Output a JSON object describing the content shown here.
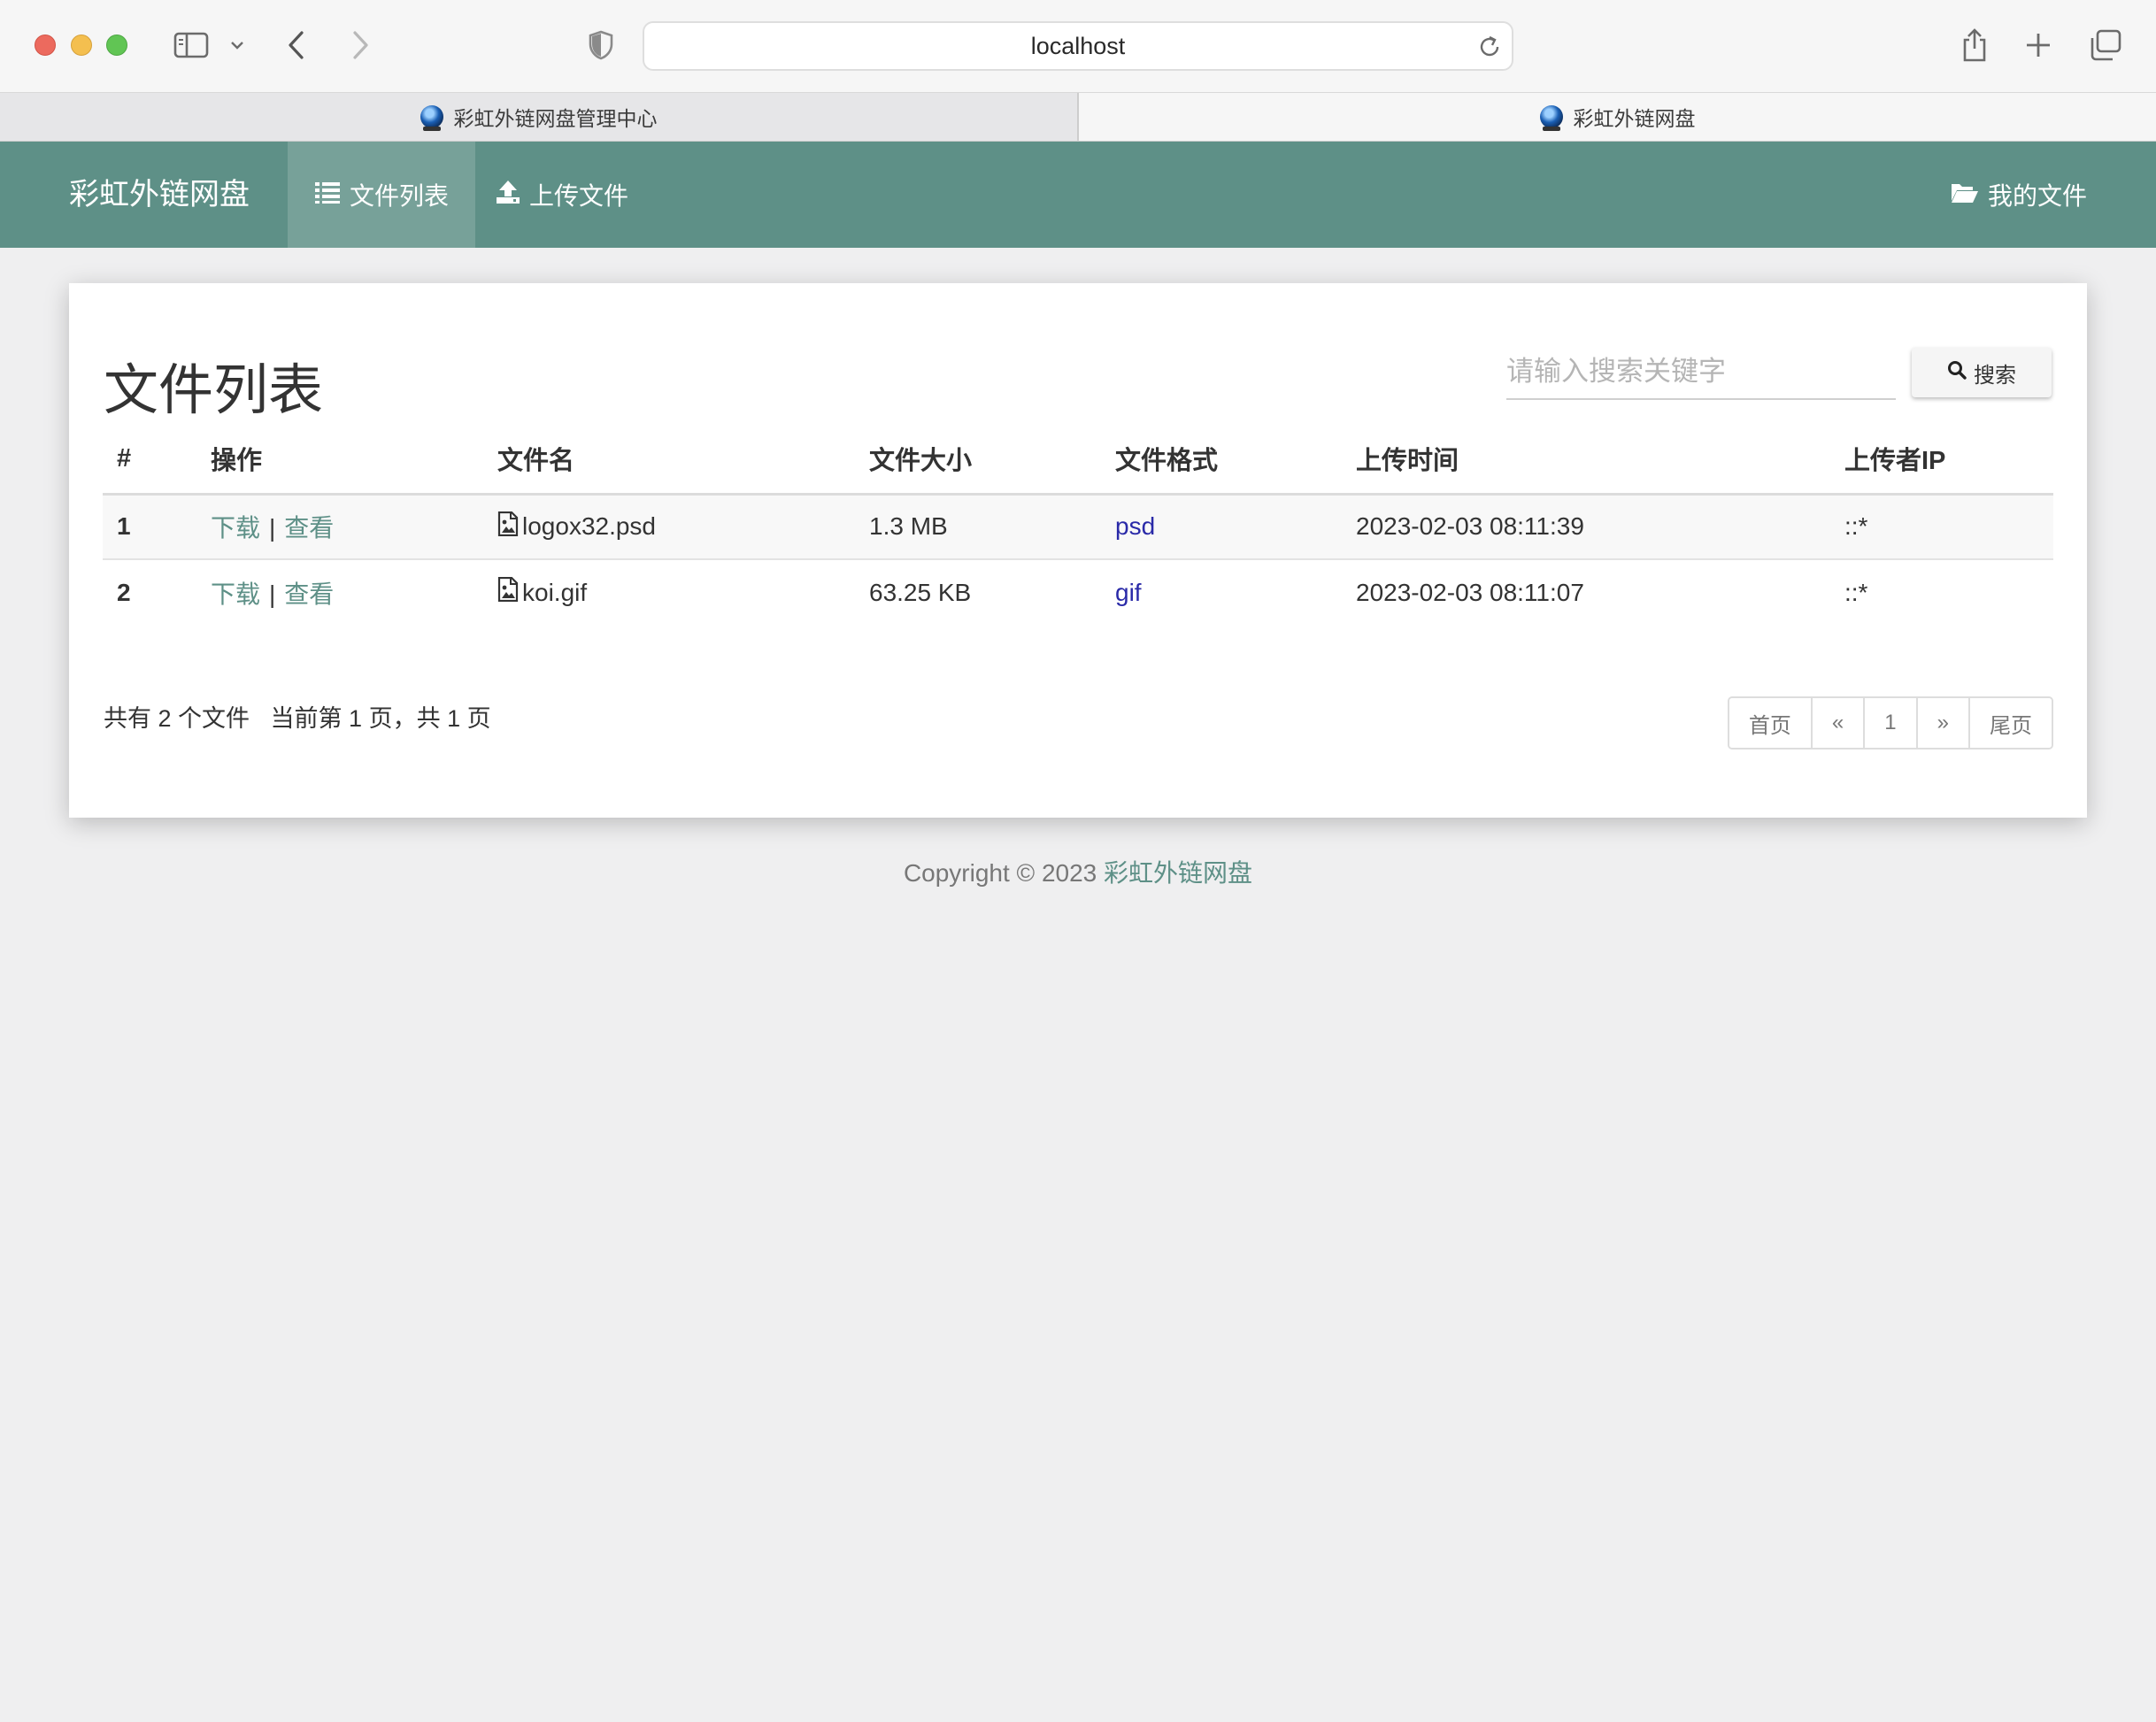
{
  "browser": {
    "url": "localhost",
    "tabs": [
      {
        "label": "彩虹外链网盘管理中心",
        "active": false
      },
      {
        "label": "彩虹外链网盘",
        "active": true
      }
    ]
  },
  "navbar": {
    "brand": "彩虹外链网盘",
    "items": [
      {
        "label": "文件列表",
        "icon": "list-icon",
        "active": true
      },
      {
        "label": "上传文件",
        "icon": "upload-icon",
        "active": false
      }
    ],
    "right_item": {
      "label": "我的文件",
      "icon": "folder-open-icon"
    },
    "color": "#5e9087"
  },
  "page": {
    "title": "文件列表",
    "search": {
      "placeholder": "请输入搜索关键字",
      "value": "",
      "button_label": "搜索"
    }
  },
  "table": {
    "headers": [
      "#",
      "操作",
      "文件名",
      "文件大小",
      "文件格式",
      "上传时间",
      "上传者IP"
    ],
    "rows": [
      {
        "index": "1",
        "action_download": "下载",
        "action_view": "查看",
        "name": "logox32.psd",
        "size": "1.3 MB",
        "format": "psd",
        "time": "2023-02-03 08:11:39",
        "ip": "::*"
      },
      {
        "index": "2",
        "action_download": "下载",
        "action_view": "查看",
        "name": "koi.gif",
        "size": "63.25 KB",
        "format": "gif",
        "time": "2023-02-03 08:11:07",
        "ip": "::*"
      }
    ]
  },
  "summary": {
    "count_text": "共有 2 个文件",
    "page_text": "当前第 1 页，共 1 页"
  },
  "pagination": {
    "first": "首页",
    "prev": "«",
    "current": "1",
    "next": "»",
    "last": "尾页"
  },
  "footer": {
    "prefix": "Copyright © 2023 ",
    "link": "彩虹外链网盘"
  }
}
